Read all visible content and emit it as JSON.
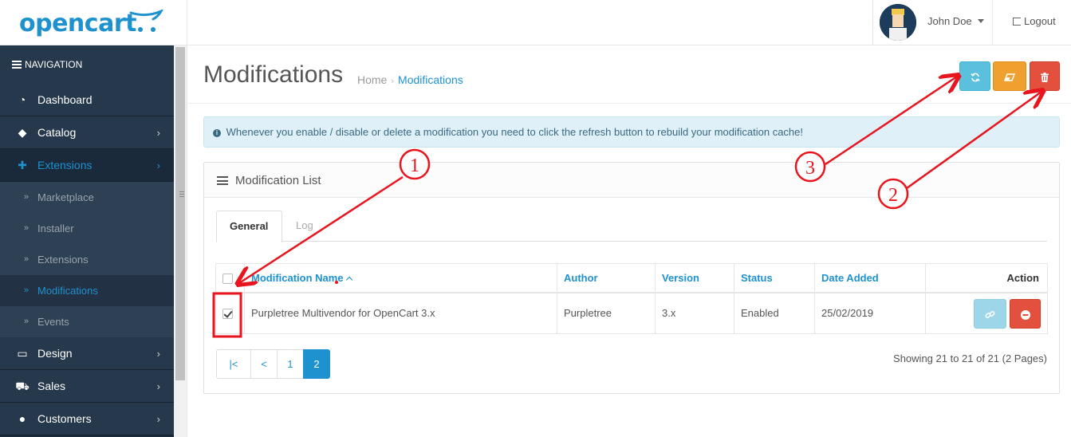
{
  "header": {
    "logo_text": "opencart",
    "user_name": "John Doe",
    "logout_label": "Logout"
  },
  "sidebar": {
    "heading": "NAVIGATION",
    "items": [
      {
        "label": "Dashboard",
        "icon": "dashboard-icon"
      },
      {
        "label": "Catalog",
        "icon": "tag-icon"
      },
      {
        "label": "Extensions",
        "icon": "puzzle-icon",
        "active": true
      },
      {
        "label": "Design",
        "icon": "monitor-icon"
      },
      {
        "label": "Sales",
        "icon": "cart-icon"
      },
      {
        "label": "Customers",
        "icon": "user-icon"
      }
    ],
    "subitems": [
      {
        "label": "Marketplace"
      },
      {
        "label": "Installer"
      },
      {
        "label": "Extensions"
      },
      {
        "label": "Modifications",
        "active": true
      },
      {
        "label": "Events"
      }
    ]
  },
  "page": {
    "title": "Modifications",
    "breadcrumb": [
      "Home",
      "Modifications"
    ]
  },
  "alert": {
    "text": "Whenever you enable / disable or delete a modification you need to click the refresh button to rebuild your modification cache!"
  },
  "panel": {
    "title": "Modification List",
    "tabs": [
      "General",
      "Log"
    ]
  },
  "table": {
    "headers": [
      "Modification Name",
      "Author",
      "Version",
      "Status",
      "Date Added",
      "Action"
    ],
    "rows": [
      {
        "name": "Purpletree Multivendor for OpenCart 3.x",
        "author": "Purpletree",
        "version": "3.x",
        "status": "Enabled",
        "date_added": "25/02/2019",
        "checked": true
      }
    ]
  },
  "pagination": {
    "pages": [
      "|<",
      "<",
      "1",
      "2"
    ],
    "current": "2",
    "showing": "Showing 21 to 21 of 21 (2 Pages)"
  },
  "annotations": [
    "1",
    "2",
    "3"
  ],
  "colors": {
    "brand": "#1e91cf",
    "sidebar": "#26384b",
    "refresh": "#5bc0de",
    "clear": "#f0a02e",
    "delete": "#e3503e",
    "annotation": "#e8141e"
  }
}
